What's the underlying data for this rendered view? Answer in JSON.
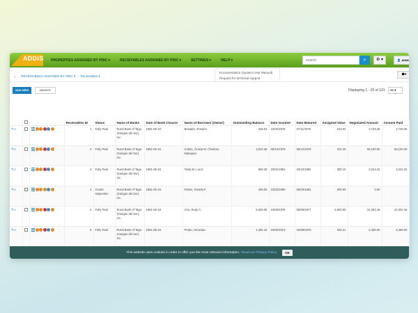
{
  "navbar": {
    "logo_text": "ADDiS",
    "items": [
      "PROPERTIES ASSIGNED BY PDIC ▾",
      "RECEIVABLES ASSIGNED BY PDIC ▾",
      "SETTINGS ▾",
      "HELP ▾"
    ],
    "search_placeholder": "search",
    "search_icon": "search-icon",
    "gear_label": "⚙ ▾",
    "user_label": "👤 ADMIN ▾"
  },
  "help_menu": [
    "Documentation (System User Manual)",
    "Request for technical support"
  ],
  "breadcrumb": {
    "home_icon": "home-icon",
    "items": [
      "RECEIVABLES ASSIGNED BY PDIC ▾",
      "Receivables ▾"
    ]
  },
  "toolbar": {
    "add_label": "ADD NEW",
    "delete_label": "DELETE",
    "paging_text": "Displaying 1 - 20 of 101",
    "per_page": "20 ▾",
    "right_btn": "☗▾"
  },
  "table": {
    "headers": [
      "",
      "",
      "",
      "Receivables ID",
      "Status",
      "Name of Banks",
      "Date of Bank Closure",
      "Name of Borrower (Owner)",
      "Outstanding Balance",
      "Date Granted",
      "Date Matured",
      "Assigned Value",
      "Negotiated Amount",
      "Amount Paid"
    ],
    "rows": [
      {
        "id": "1",
        "status": "Fully Paid",
        "bank": "Rural Bank of Tago (Surigao del Sur), Inc.",
        "closure": "1991-05-15",
        "borrower": "Basadre, Rosario",
        "balance": "445.04",
        "granted": "10/02/1976",
        "matured": "07/11/1976",
        "assigned": "223.02",
        "negotiated": "2,728.25",
        "paid": "2,728.25"
      },
      {
        "id": "2",
        "status": "Fully Paid",
        "bank": "Rural Bank of Tago (Surigao del Sur), Inc.",
        "closure": "1991-05-15",
        "borrower": "Coleto, Gracia M. (Teotimo Malaque)",
        "balance": "1,022.28",
        "granted": "05/12/1978",
        "matured": "05/12/1979",
        "assigned": "511.20",
        "negotiated": "56,100.00",
        "paid": "56,100.00"
      },
      {
        "id": "3",
        "status": "Fully Paid",
        "bank": "Rural Bank of Tago (Surigao del Sur), Inc.",
        "closure": "1991-05-15",
        "borrower": "Tesla M. Lucor",
        "balance": "600.28",
        "granted": "20/01/1981",
        "matured": "20/10/1982",
        "assigned": "300.14",
        "negotiated": "3,224.32",
        "paid": "3,224.32"
      },
      {
        "id": "4",
        "status": "Ocular Inspection",
        "bank": "Rural Bank of Tago (Surigao del Sur), Inc.",
        "closure": "1991-05-15",
        "borrower": "Patino, Rosela F.",
        "balance": "400.00",
        "granted": "10/03/1980",
        "matured": "05/03/1981",
        "assigned": "200.00",
        "negotiated": "0.00",
        "paid": ""
      },
      {
        "id": "5",
        "status": "Fully Paid",
        "bank": "Rural Bank of Tago (Surigao del Sur), Inc.",
        "closure": "1991-05-15",
        "borrower": "Chu, Rudy C.",
        "balance": "5,000.00",
        "granted": "10/09/1976",
        "matured": "05/09/1977",
        "assigned": "2,500.00",
        "negotiated": "31,002.18",
        "paid": "31,002.18"
      },
      {
        "id": "6",
        "status": "Fully Paid",
        "bank": "Rural Bank of Tago (Surigao del Sur), Inc.",
        "closure": "1991-05-15",
        "borrower": "Prado, Heraclao",
        "balance": "1,292.42",
        "granted": "16/06/1974",
        "matured": "15/08/1975",
        "assigned": "646.21",
        "negotiated": "2,456.00",
        "paid": "2,456.00"
      }
    ]
  },
  "cookie": {
    "text": "This website uses cookies in order to offer you the most relevant information.",
    "link": "Read our Privacy Policy",
    "ok": "OK"
  },
  "colors": {
    "accent": "#1a7fbf",
    "nav_green": "#6fb22a",
    "logo": "#f0b010",
    "cookie_bar": "#2f5d5c"
  }
}
